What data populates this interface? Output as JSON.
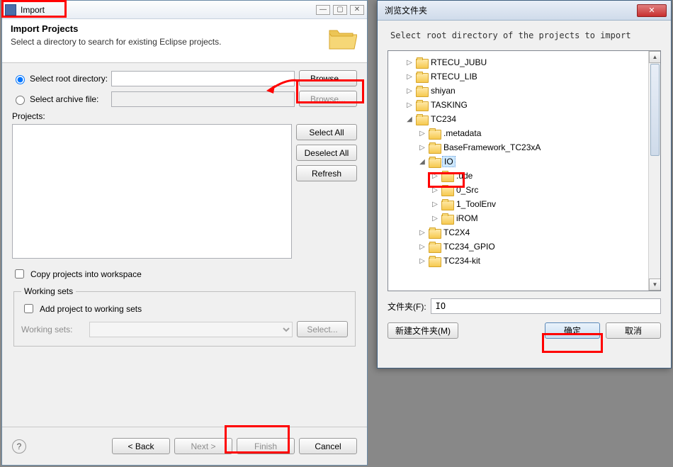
{
  "import": {
    "title": "Import",
    "banner_title": "Import Projects",
    "banner_desc": "Select a directory to search for existing Eclipse projects.",
    "radio_root": "Select root directory:",
    "radio_archive": "Select archive file:",
    "browse": "Browse...",
    "projects_label": "Projects:",
    "select_all": "Select All",
    "deselect_all": "Deselect All",
    "refresh": "Refresh",
    "copy_projects": "Copy projects into workspace",
    "working_sets_legend": "Working sets",
    "add_ws": "Add project to working sets",
    "ws_label": "Working sets:",
    "select_btn": "Select...",
    "back": "< Back",
    "next": "Next >",
    "finish": "Finish",
    "cancel": "Cancel",
    "root_value": "",
    "archive_value": ""
  },
  "browse": {
    "title": "浏览文件夹",
    "prompt": "Select root directory of the projects to import",
    "folder_label": "文件夹(F):",
    "folder_value": "IO",
    "new_folder": "新建文件夹(M)",
    "ok": "确定",
    "cancel": "取消",
    "tree": [
      {
        "depth": 0,
        "exp": "▷",
        "label": "RTECU_JUBU"
      },
      {
        "depth": 0,
        "exp": "▷",
        "label": "RTECU_LIB"
      },
      {
        "depth": 0,
        "exp": "▷",
        "label": "shiyan"
      },
      {
        "depth": 0,
        "exp": "▷",
        "label": "TASKING"
      },
      {
        "depth": 0,
        "exp": "◢",
        "label": "TC234"
      },
      {
        "depth": 1,
        "exp": "▷",
        "label": ".metadata"
      },
      {
        "depth": 1,
        "exp": "▷",
        "label": "BaseFramework_TC23xA"
      },
      {
        "depth": 1,
        "exp": "◢",
        "label": "IO",
        "selected": true
      },
      {
        "depth": 2,
        "exp": "▷",
        "label": ".ude"
      },
      {
        "depth": 2,
        "exp": "▷",
        "label": "0_Src"
      },
      {
        "depth": 2,
        "exp": "▷",
        "label": "1_ToolEnv"
      },
      {
        "depth": 2,
        "exp": "▷",
        "label": "iROM"
      },
      {
        "depth": 1,
        "exp": "▷",
        "label": "TC2X4"
      },
      {
        "depth": 1,
        "exp": "▷",
        "label": "TC234_GPIO"
      },
      {
        "depth": 1,
        "exp": "▷",
        "label": "TC234-kit"
      }
    ]
  }
}
